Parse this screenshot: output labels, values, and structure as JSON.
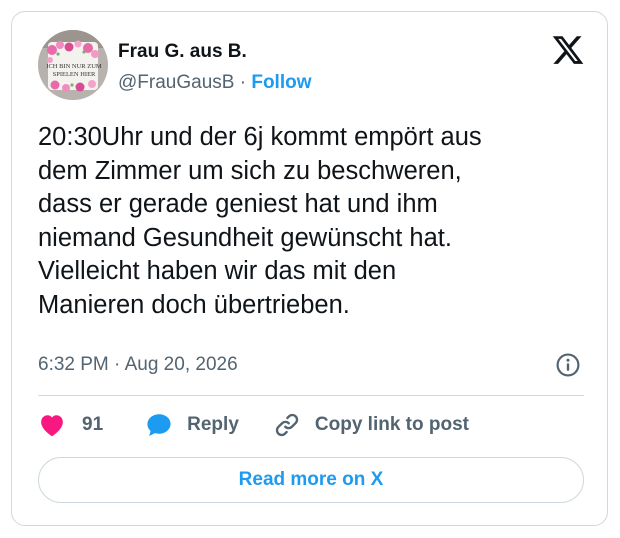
{
  "author": {
    "name": "Frau G. aus B.",
    "handle": "@FrauGausB",
    "separator": "·",
    "follow_label": "Follow",
    "avatar_mug_text": "ICH BIN NUR ZUM\nSPIELEN HIER"
  },
  "tweet": {
    "text": "20:30Uhr und der 6j kommt empört aus\ndem Zimmer um sich zu beschweren,\ndass er gerade geniest hat und ihm\nniemand Gesundheit gewünscht hat.\nVielleicht haben wir das mit den\nManieren doch übertrieben.",
    "timestamp": "6:32 PM · Aug 20, 2026"
  },
  "actions": {
    "like_count": "91",
    "reply_label": "Reply",
    "copy_label": "Copy link to post"
  },
  "read_more_label": "Read more on X",
  "colors": {
    "accent": "#1d9bf0",
    "like": "#f91880",
    "text": "#0f1419",
    "muted": "#536471",
    "border": "#cfd9de"
  },
  "icons": {
    "brand": "x-logo-icon",
    "info": "info-icon",
    "like": "heart-icon",
    "reply": "speech-bubble-icon",
    "copy": "link-icon"
  }
}
